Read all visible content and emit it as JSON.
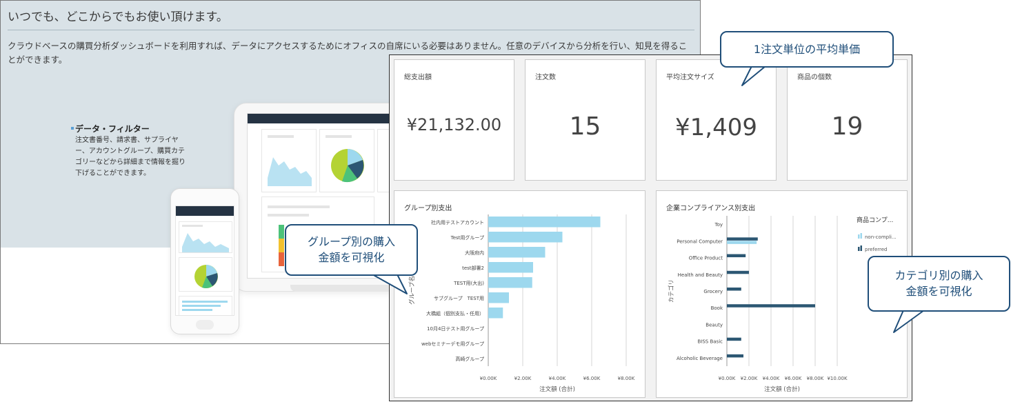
{
  "background": {
    "title": "いつでも、どこからでもお使い頂けます。",
    "description": "クラウドベースの購買分析ダッシュボードを利用すれば、データにアクセスするためにオフィスの自席にいる必要はありません。任意のデバイスから分析を行い、知見を得ることができます。",
    "feature_title": "データ・フィルター",
    "feature_text": "注文書番号、請求書、サプライヤー、アカウントグループ、購買カテゴリーなどから詳細まで情報を掘り下げることができます。"
  },
  "kpis": [
    {
      "label": "総支出額",
      "value": "¥21,132.00"
    },
    {
      "label": "注文数",
      "value": "15"
    },
    {
      "label": "平均注文サイズ",
      "value": "¥1,409"
    },
    {
      "label": "商品の個数",
      "value": "19"
    }
  ],
  "callouts": {
    "avg_price": "1注文単位の平均単価",
    "group_line1": "グループ別の購入",
    "group_line2": "金額を可視化",
    "category_line1": "カテゴリ別の購入",
    "category_line2": "金額を可視化"
  },
  "colors": {
    "bar_light": "#9dd8ee",
    "bar_dark": "#2c5773",
    "callout_border": "#1f4e79"
  },
  "chart_data": [
    {
      "type": "bar",
      "orientation": "horizontal",
      "title": "グループ別支出",
      "xlabel": "注文額 (合計)",
      "ylabel": "グループ名",
      "xlim": [
        0,
        8000
      ],
      "xticks": [
        "¥0.00K",
        "¥2.00K",
        "¥4.00K",
        "¥6.00K",
        "¥8.00K"
      ],
      "categories": [
        "社内用テストアカウント",
        "Test用グループ",
        "大阪府内",
        "test部署2",
        "TEST用(大出)",
        "サブグループ　TEST用",
        "大橋組（個別支払・任用）",
        "10月4日テスト用グループ",
        "webセミナーデモ用グループ",
        "高崎グループ"
      ],
      "values": [
        6500,
        4300,
        3300,
        2600,
        2550,
        1200,
        850,
        0,
        0,
        0
      ],
      "color": "#9dd8ee"
    },
    {
      "type": "bar",
      "orientation": "horizontal",
      "title": "企業コンプライアンス別支出",
      "xlabel": "注文額 (合計)",
      "ylabel": "カテゴリ",
      "xlim": [
        0,
        10000
      ],
      "xticks": [
        "¥0.00K",
        "¥2.00K",
        "¥4.00K",
        "¥6.00K",
        "¥8.00K",
        "¥10.00K"
      ],
      "legend_title": "商品コンプ...",
      "legend_position": "right",
      "categories": [
        "Toy",
        "Personal Computer",
        "Office Product",
        "Health and Beauty",
        "Grocery",
        "Book",
        "Beauty",
        "BISS Basic",
        "Alcoholic Beverage"
      ],
      "series": [
        {
          "name": "non-compli...",
          "values": [
            0,
            2700,
            0,
            0,
            0,
            0,
            0,
            0,
            0
          ],
          "color": "#9dd8ee"
        },
        {
          "name": "preferred",
          "values": [
            0,
            2800,
            1700,
            2000,
            1300,
            8000,
            0,
            1300,
            1500
          ],
          "color": "#2c5773"
        }
      ]
    }
  ]
}
